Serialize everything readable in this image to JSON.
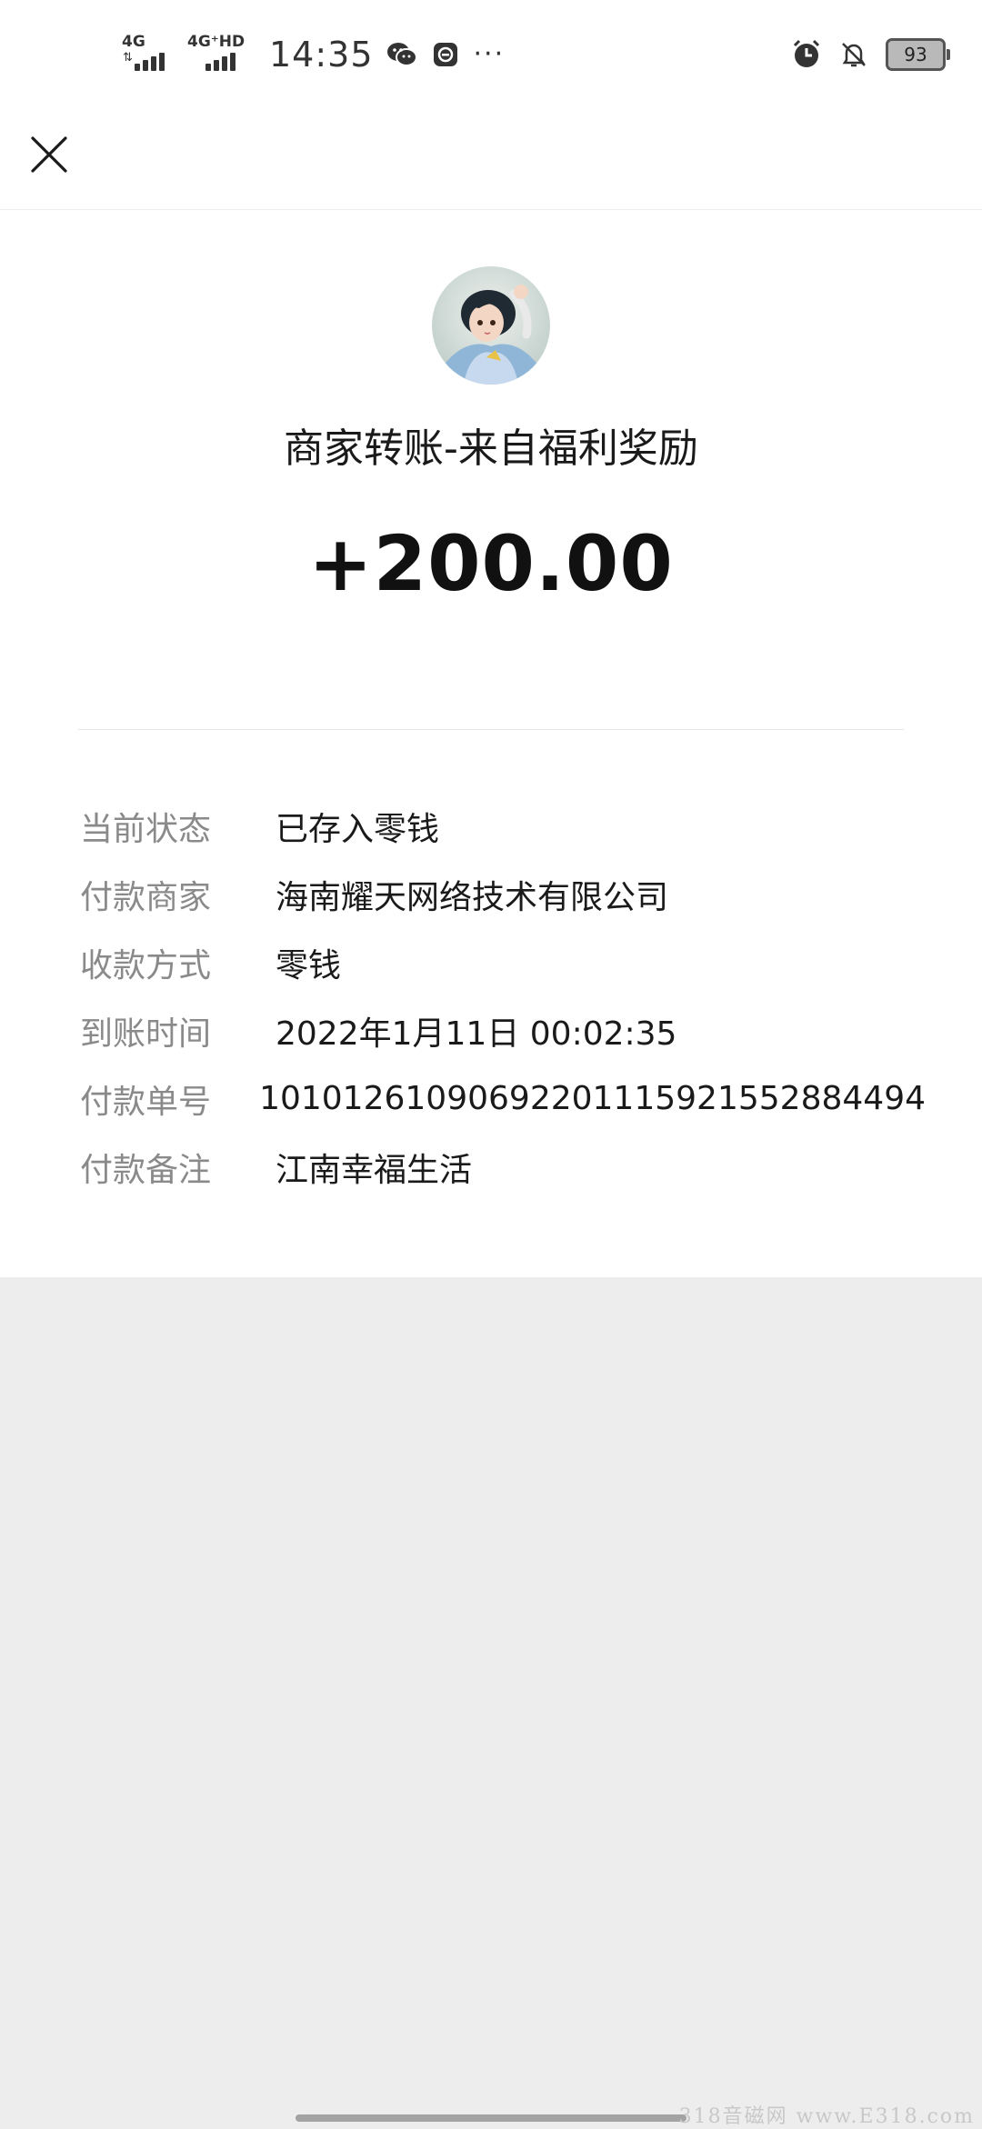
{
  "status_bar": {
    "net1_label": "4G",
    "net2_label": "4G⁺HD",
    "time": "14:35",
    "battery_level": "93",
    "icons": [
      "wechat-icon",
      "chat-bubble-icon",
      "more-dots-icon",
      "alarm-icon",
      "bell-off-icon",
      "battery-icon"
    ]
  },
  "nav": {
    "close_icon": "close-icon"
  },
  "transfer": {
    "title": "商家转账-来自福利奖励",
    "amount": "+200.00",
    "details": [
      {
        "key": "当前状态",
        "value": "已存入零钱"
      },
      {
        "key": "付款商家",
        "value": "海南耀天网络技术有限公司"
      },
      {
        "key": "收款方式",
        "value": "零钱"
      },
      {
        "key": "到账时间",
        "value": "2022年1月11日 00:02:35"
      },
      {
        "key": "付款单号",
        "value": "101012610906922011159215528844​94"
      },
      {
        "key": "付款备注",
        "value": "江南幸福生活"
      }
    ]
  },
  "watermark": "318音磁网 www.E318.com",
  "colors": {
    "page_bg": "#ededed",
    "card_bg": "#ffffff",
    "label_gray": "#8a8a8a",
    "text_dark": "#1a1a1a"
  }
}
